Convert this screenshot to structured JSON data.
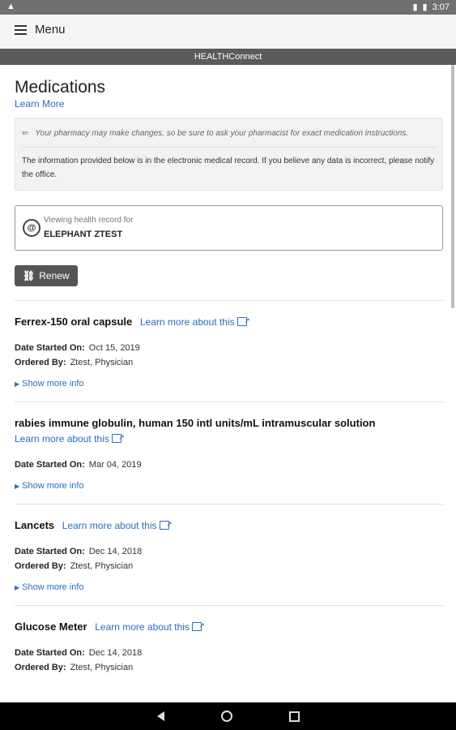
{
  "status": {
    "time": "3:07"
  },
  "appbar": {
    "menu_label": "Menu"
  },
  "brand": {
    "title": "HEALTHConnect"
  },
  "page": {
    "title": "Medications",
    "learn_more": "Learn More",
    "notice_tip": "Your pharmacy may make changes, so be sure to ask your pharmacist for exact medication instructions.",
    "notice_info": "The information provided below is in the electronic medical record. If you believe any data is incorrect, please notify the office.",
    "viewing_label": "Viewing health record for",
    "viewing_name": "ELEPHANT ZTEST",
    "renew_label": "Renew"
  },
  "medications": [
    {
      "name": "Ferrex-150 oral capsule",
      "link": "Learn more about this",
      "date_label": "Date Started On:",
      "date": "Oct 15, 2019",
      "ordered_label": "Ordered By:",
      "ordered": "Ztest, Physician",
      "show_more": "Show more info"
    },
    {
      "name": "rabies immune globulin, human 150 intl units/mL intramuscular solution",
      "link": "Learn more about this",
      "date_label": "Date Started On:",
      "date": "Mar 04, 2019",
      "show_more": "Show more info"
    },
    {
      "name": "Lancets",
      "link": "Learn more about this",
      "date_label": "Date Started On:",
      "date": "Dec 14, 2018",
      "ordered_label": "Ordered By:",
      "ordered": "Ztest, Physician",
      "show_more": "Show more info"
    },
    {
      "name": "Glucose Meter",
      "link": "Learn more about this",
      "date_label": "Date Started On:",
      "date": "Dec 14, 2018",
      "ordered_label": "Ordered By:",
      "ordered": "Ztest, Physician"
    }
  ]
}
